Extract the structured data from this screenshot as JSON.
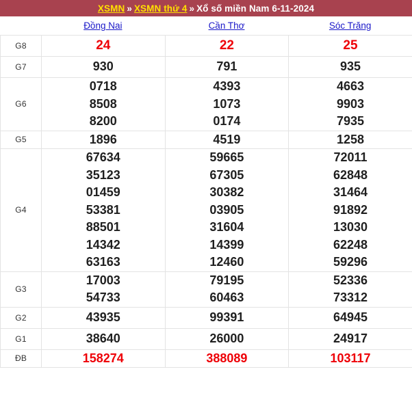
{
  "header": {
    "crumb1": "XSMN",
    "sep1": "»",
    "crumb2": "XSMN thứ 4",
    "sep2": "»",
    "tail": "Xổ số miền Nam 6-11-2024",
    "background_color": "#a8424f",
    "link_color": "#ffe000",
    "text_color": "#ffffff"
  },
  "columns": [
    {
      "name": "Đồng Nai"
    },
    {
      "name": "Cần Thơ"
    },
    {
      "name": "Sóc Trăng"
    }
  ],
  "column_link_color": "#1a18c8",
  "highlight_color": "#ee0007",
  "rows": [
    {
      "label": "G8",
      "highlight": true,
      "values": [
        [
          "24"
        ],
        [
          "22"
        ],
        [
          "25"
        ]
      ]
    },
    {
      "label": "G7",
      "highlight": false,
      "values": [
        [
          "930"
        ],
        [
          "791"
        ],
        [
          "935"
        ]
      ]
    },
    {
      "label": "G6",
      "highlight": false,
      "values": [
        [
          "0718",
          "8508",
          "8200"
        ],
        [
          "4393",
          "1073",
          "0174"
        ],
        [
          "4663",
          "9903",
          "7935"
        ]
      ]
    },
    {
      "label": "G5",
      "highlight": false,
      "values": [
        [
          "1896"
        ],
        [
          "4519"
        ],
        [
          "1258"
        ]
      ]
    },
    {
      "label": "G4",
      "highlight": false,
      "values": [
        [
          "67634",
          "35123",
          "01459",
          "53381",
          "88501",
          "14342",
          "63163"
        ],
        [
          "59665",
          "67305",
          "30382",
          "03905",
          "31604",
          "14399",
          "12460"
        ],
        [
          "72011",
          "62848",
          "31464",
          "91892",
          "13030",
          "62248",
          "59296"
        ]
      ]
    },
    {
      "label": "G3",
      "highlight": false,
      "values": [
        [
          "17003",
          "54733"
        ],
        [
          "79195",
          "60463"
        ],
        [
          "52336",
          "73312"
        ]
      ]
    },
    {
      "label": "G2",
      "highlight": false,
      "values": [
        [
          "43935"
        ],
        [
          "99391"
        ],
        [
          "64945"
        ]
      ]
    },
    {
      "label": "G1",
      "highlight": false,
      "values": [
        [
          "38640"
        ],
        [
          "26000"
        ],
        [
          "24917"
        ]
      ]
    },
    {
      "label": "ĐB",
      "highlight": true,
      "values": [
        [
          "158274"
        ],
        [
          "388089"
        ],
        [
          "103117"
        ]
      ]
    }
  ]
}
